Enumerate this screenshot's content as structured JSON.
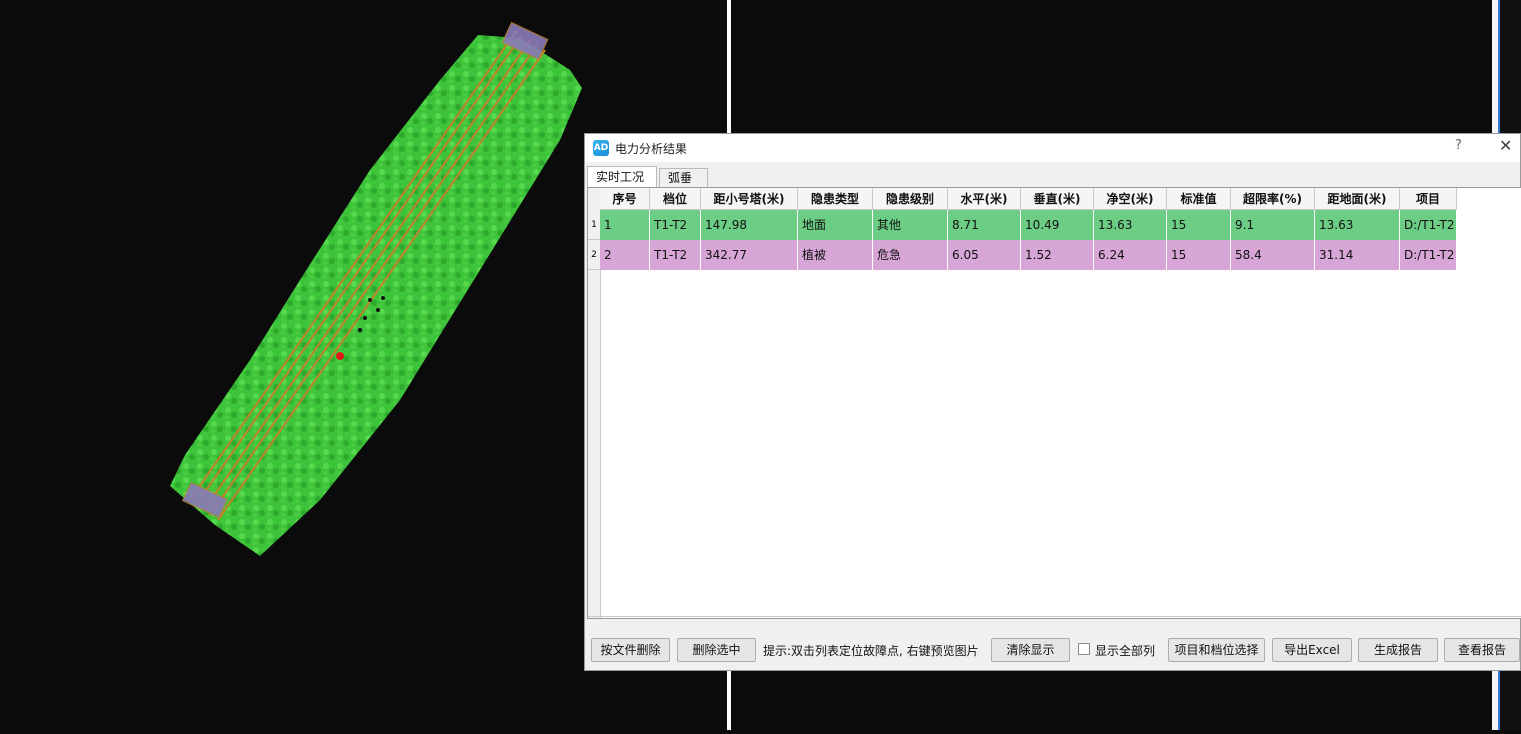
{
  "dialog": {
    "icon_text": "AD",
    "title": "电力分析结果",
    "help": "?",
    "close": "✕",
    "tabs": [
      "实时工况",
      "弧垂"
    ]
  },
  "table": {
    "columns": [
      "序号",
      "档位",
      "距小号塔(米)",
      "隐患类型",
      "隐患级别",
      "水平(米)",
      "垂直(米)",
      "净空(米)",
      "标准值",
      "超限率(%)",
      "距地面(米)",
      "项目"
    ],
    "row_numbers": [
      "1",
      "2"
    ],
    "rows": [
      [
        "1",
        "T1-T2",
        "147.98",
        "地面",
        "其他",
        "8.71",
        "10.49",
        "13.63",
        "15",
        "9.1",
        "13.63",
        "D:/T1-T2"
      ],
      [
        "2",
        "T1-T2",
        "342.77",
        "植被",
        "危急",
        "6.05",
        "1.52",
        "6.24",
        "15",
        "58.4",
        "31.14",
        "D:/T1-T2"
      ]
    ],
    "row_colors": [
      "#6ccd84",
      "#d7a6d7"
    ]
  },
  "toolbar": {
    "delete_by_file": "按文件删除",
    "delete_selected": "删除选中",
    "hint": "提示:双击列表定位故障点, 右键预览图片",
    "clear_display": "清除显示",
    "show_all_columns": "显示全部列",
    "project_span_select": "项目和档位选择",
    "export_excel": "导出Excel",
    "generate_report": "生成报告",
    "view_report": "查看报告"
  },
  "colors": {
    "vegetation": "#3ec43a",
    "power_line": "#b8862b",
    "tower": "#8a7ab8",
    "hazard": "#e01818"
  }
}
